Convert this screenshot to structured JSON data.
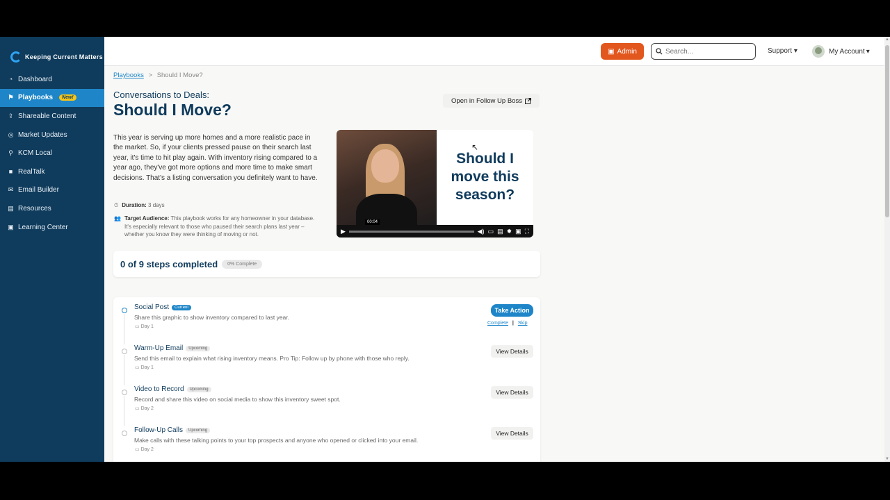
{
  "brand": {
    "name": "Keeping Current Matters"
  },
  "sidebar": {
    "items": [
      {
        "label": "Dashboard",
        "icon": "dashboard-icon",
        "glyph": "◔"
      },
      {
        "label": "Playbooks",
        "icon": "playbook-icon",
        "glyph": "⚑",
        "badge": "New!",
        "active": true
      },
      {
        "label": "Shareable Content",
        "icon": "share-icon",
        "glyph": "⇪"
      },
      {
        "label": "Market Updates",
        "icon": "market-icon",
        "glyph": "◎"
      },
      {
        "label": "KCM Local",
        "icon": "location-icon",
        "glyph": "⚲"
      },
      {
        "label": "RealTalk",
        "icon": "video-icon",
        "glyph": "■"
      },
      {
        "label": "Email Builder",
        "icon": "email-icon",
        "glyph": "✉"
      },
      {
        "label": "Resources",
        "icon": "resources-icon",
        "glyph": "▤"
      },
      {
        "label": "Learning Center",
        "icon": "learning-icon",
        "glyph": "▣"
      }
    ]
  },
  "topbar": {
    "admin_label": "Admin",
    "search_placeholder": "Search...",
    "support_label": "Support",
    "account_label": "My Account"
  },
  "breadcrumb": {
    "parent": "Playbooks",
    "separator": ">",
    "current": "Should I Move?"
  },
  "playbook": {
    "subtitle": "Conversations to Deals:",
    "title": "Should I Move?",
    "open_button": "Open in Follow Up Boss",
    "description": "This year is serving up more homes and a more realistic pace in the market. So, if your clients pressed pause on their search last year, it's time to hit play again. With inventory rising compared to a year ago, they've got more options and more time to make smart decisions. That's a listing conversation you definitely want to have.",
    "duration_label": "Duration:",
    "duration_value": "3 days",
    "audience_label": "Target Audience:",
    "audience_value": "This playbook works for any homeowner in your database. It's especially relevant to those who paused their search plans last year – whether you know they were thinking of moving or not."
  },
  "video": {
    "headline": "Should I move this season?",
    "timestamp": "00:04"
  },
  "progress": {
    "text": "0 of 9 steps completed",
    "percent_label": "0% Complete",
    "completed": 0,
    "total": 9
  },
  "steps": [
    {
      "name": "Social Post",
      "tag": "Current",
      "desc": "Share this graphic to show inventory compared to last year.",
      "day": "Day 1",
      "action": "Take Action",
      "complete": "Complete",
      "skip": "Skip"
    },
    {
      "name": "Warm-Up Email",
      "tag": "Upcoming",
      "desc": "Send this email to explain what rising inventory means. Pro Tip: Follow up by phone with those who reply.",
      "day": "Day 1",
      "action": "View Details"
    },
    {
      "name": "Video to Record",
      "tag": "Upcoming",
      "desc": "Record and share this video on social media to show this inventory sweet spot.",
      "day": "Day 2",
      "action": "View Details"
    },
    {
      "name": "Follow-Up Calls",
      "tag": "Upcoming",
      "desc": "Make calls with these talking points to your top prospects and anyone who opened or clicked into your email.",
      "day": "Day 2",
      "action": "View Details"
    }
  ],
  "colors": {
    "sidebar": "#0f3b5c",
    "accent": "#1e86c8",
    "admin": "#e2571e",
    "badge": "#f5c518"
  }
}
